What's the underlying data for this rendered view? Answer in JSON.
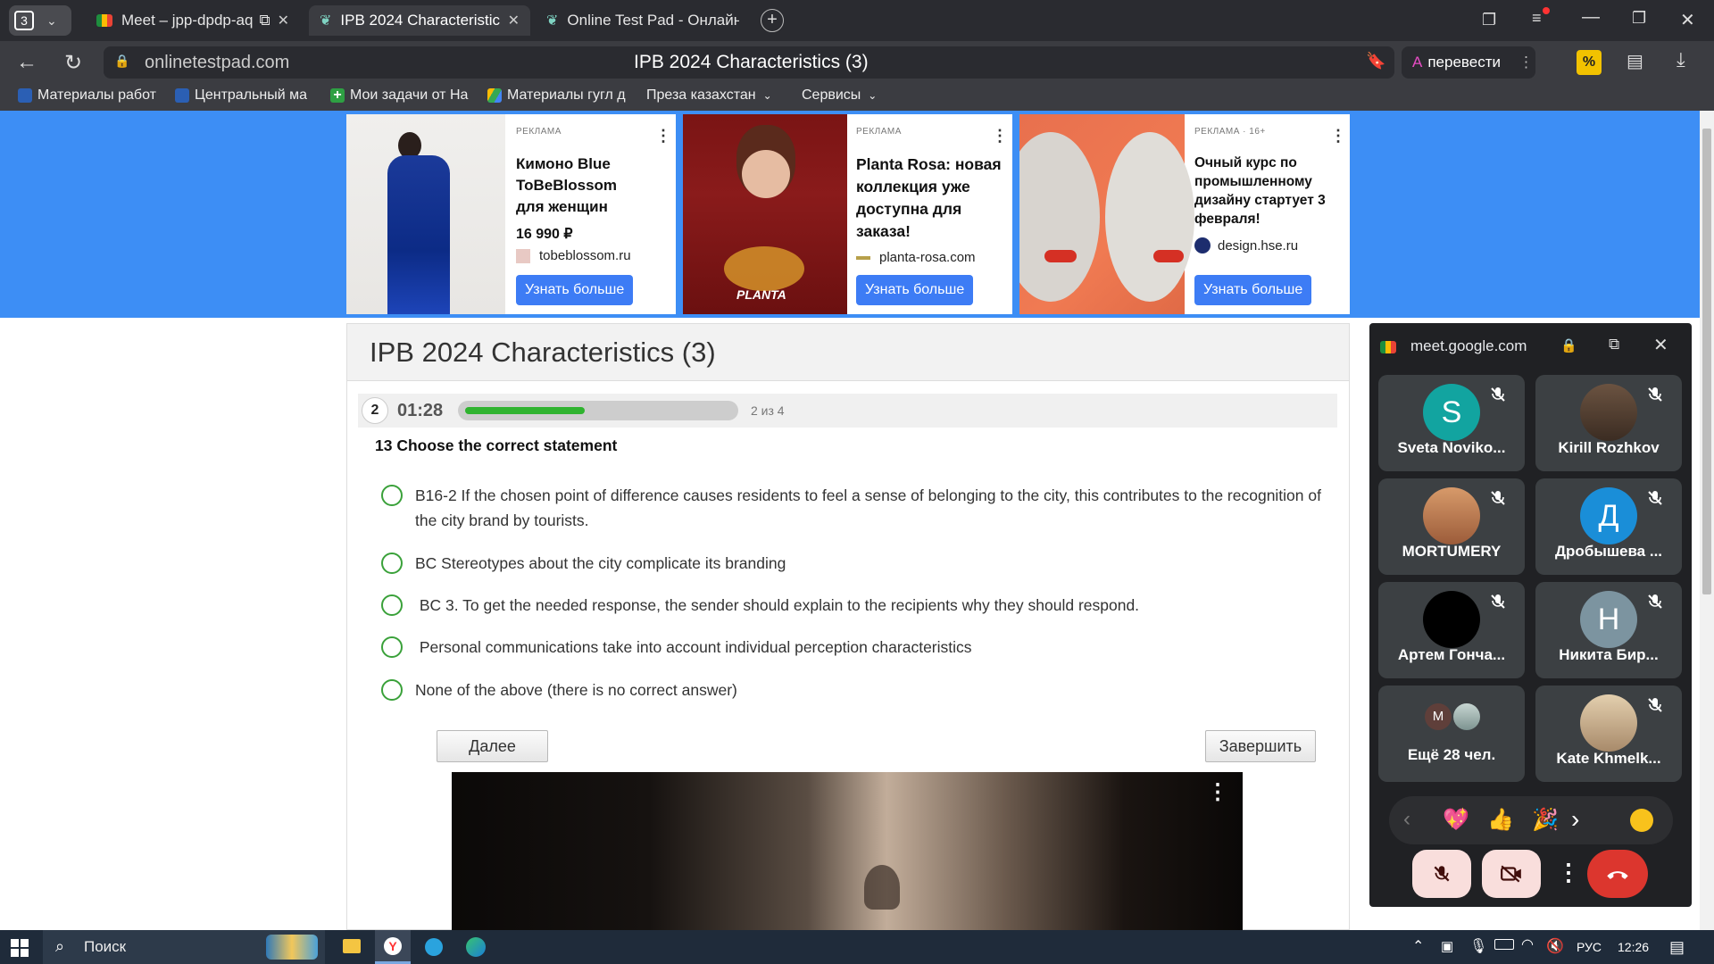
{
  "browser": {
    "tab_count": "3",
    "tabs": [
      {
        "title": "Meet – jpp-dpdp-aq"
      },
      {
        "title": "IPB 2024 Characteristic"
      },
      {
        "title": "Online Test Pad - Онлайн"
      }
    ],
    "url": "onlinetestpad.com",
    "page_title": "IPB 2024 Characteristics (3)",
    "translate_label": "перевести"
  },
  "bookmarks": [
    {
      "label": "Материалы работ"
    },
    {
      "label": "Центральный ма"
    },
    {
      "label": "Мои задачи от На"
    },
    {
      "label": "Материалы гугл д"
    },
    {
      "label": "Преза казахстан",
      "has_menu": true
    },
    {
      "label": "Сервисы",
      "has_menu": true
    }
  ],
  "ads": [
    {
      "label": "РЕКЛАМА",
      "title": "Кимоно Blue ToBeBlossom для женщин",
      "price": "16 990 ₽",
      "domain": "tobeblossom.ru",
      "button": "Узнать больше"
    },
    {
      "label": "РЕКЛАМА",
      "title": "Planta Rosa: новая коллекция уже доступна для заказа!",
      "domain": "planta-rosa.com",
      "button": "Узнать больше",
      "brand_text": "PLANTA"
    },
    {
      "label": "РЕКЛАМА · 16+",
      "title": "Очный курс по промышленному дизайну стартует 3 февраля!",
      "domain": "design.hse.ru",
      "button": "Узнать больше"
    }
  ],
  "quiz": {
    "title": "IPB 2024 Characteristics (3)",
    "question_index": "2",
    "timer": "01:28",
    "progress_fraction": 0.45,
    "progress_text": "2 из 4",
    "question": "13 Choose the correct statement",
    "options": [
      "B16-2 If the chosen point of difference causes residents to feel a sense of belonging to the city, this contributes to the recognition of the city brand by tourists.",
      "BC Stereotypes about the city complicate its branding",
      " BC 3. To get the needed response, the sender should explain to the recipients why they should respond.",
      " Personal communications take into account individual perception characteristics",
      "None of the above (there is no correct answer)"
    ],
    "next_button": "Далее",
    "finish_button": "Завершить"
  },
  "meet": {
    "origin": "meet.google.com",
    "participants": [
      {
        "name": "Sveta Noviko...",
        "initial": "S",
        "color": "#12a4a0"
      },
      {
        "name": "Kirill Rozhkov",
        "initial": "",
        "color": "#5d4a3a"
      },
      {
        "name": "MORTUMERY",
        "initial": "",
        "color": "#c8875a"
      },
      {
        "name": "Дробышева ...",
        "initial": "Д",
        "color": "#1a8ed8"
      },
      {
        "name": "Артем Гонча...",
        "initial": "",
        "color": "#000000"
      },
      {
        "name": "Никита Бир...",
        "initial": "Н",
        "color": "#7c94a0"
      },
      {
        "name": "Ещё 28 чел.",
        "initial": "M",
        "color": "#5f3f3a"
      },
      {
        "name": "Kate Khmelk...",
        "initial": "",
        "color": "#d9c4a6"
      }
    ],
    "reactions": [
      "💖",
      "👍",
      "🎉"
    ]
  },
  "taskbar": {
    "search": "Поиск",
    "lang": "РУС",
    "time": "12:26"
  }
}
